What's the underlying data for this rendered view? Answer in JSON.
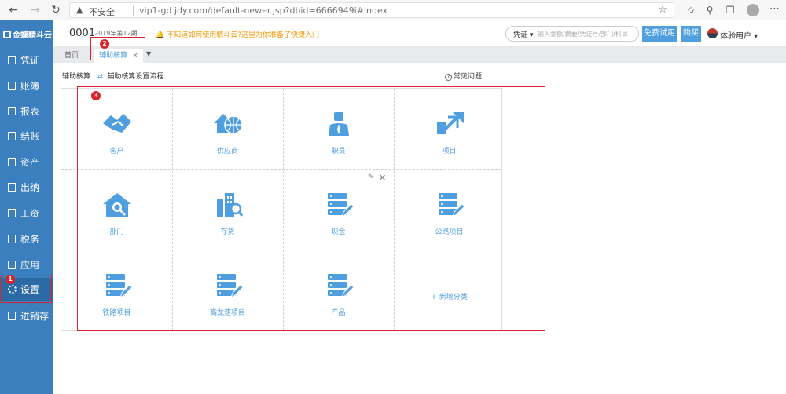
{
  "browser": {
    "insecure_label": "不安全",
    "url": "vip1-gd.jdy.com/default-newer.jsp?dbid=6666949i#index"
  },
  "sidebar": {
    "logo_text": "金蝶精斗云",
    "items": [
      {
        "label": "凭证"
      },
      {
        "label": "账簿"
      },
      {
        "label": "报表"
      },
      {
        "label": "结账"
      },
      {
        "label": "资产"
      },
      {
        "label": "出纳"
      },
      {
        "label": "工资"
      },
      {
        "label": "税务"
      },
      {
        "label": "应用"
      },
      {
        "label": "设置"
      },
      {
        "label": "进销存"
      }
    ]
  },
  "header": {
    "account_no": "0001",
    "period": "2019年第12期",
    "notice": "不知道如何使用精斗云?这里为你准备了快捷入门",
    "search_scope": "凭证",
    "search_placeholder": "输入金额/摘要/凭证号/部门/科目",
    "trial_button": "免费试用",
    "buy_button": "购买",
    "user": "体验用户"
  },
  "tabs": {
    "home": "首页",
    "current": "辅助核算",
    "close": "×",
    "more": "▼"
  },
  "content": {
    "title": "辅助核算",
    "setup_link": "辅助核算设置流程",
    "faq": "常见问题",
    "add_category": "+ 新增分类",
    "categories": [
      {
        "label": "客户"
      },
      {
        "label": "供应商"
      },
      {
        "label": "职员"
      },
      {
        "label": "项目"
      },
      {
        "label": "部门"
      },
      {
        "label": "存货"
      },
      {
        "label": "现金"
      },
      {
        "label": "公路项目"
      },
      {
        "label": "铁路项目"
      },
      {
        "label": "高龙速项目"
      },
      {
        "label": "产品"
      }
    ]
  },
  "annotations": {
    "badge1": "1",
    "badge2": "2",
    "badge3": "3"
  },
  "colors": {
    "sidebar": "#3c7fbf",
    "accent": "#4f9fe0",
    "annotation": "#d9232d"
  }
}
